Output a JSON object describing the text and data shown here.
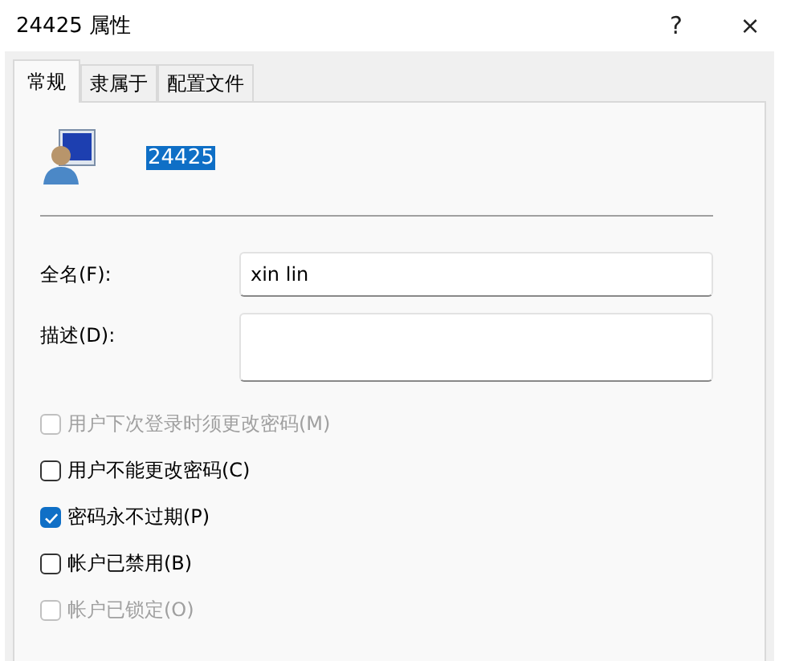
{
  "window": {
    "title": "24425 属性",
    "buttons": [
      "?",
      "×"
    ]
  },
  "tabs": [
    {
      "label": "常规",
      "selected": true
    },
    {
      "label": "隶属于",
      "selected": false
    },
    {
      "label": "配置文件",
      "selected": false
    }
  ],
  "account": {
    "name": "24425",
    "selected": true
  },
  "fields": [
    {
      "label": "全名(F):",
      "value": "xin lin",
      "kind": "line"
    },
    {
      "label": "描述(D):",
      "kind": "area"
    }
  ],
  "options": [
    {
      "label": "用户下次登录时须更改密码(M)",
      "checked": false,
      "disabled": true
    },
    {
      "label": "用户不能更改密码(C)",
      "checked": false,
      "disabled": false
    },
    {
      "label": "密码永不过期(P)",
      "checked": true,
      "disabled": false
    },
    {
      "label": "帐户已禁用(B)",
      "checked": false,
      "disabled": false
    },
    {
      "label": "帐户已锁定(O)",
      "checked": false,
      "disabled": true
    }
  ]
}
